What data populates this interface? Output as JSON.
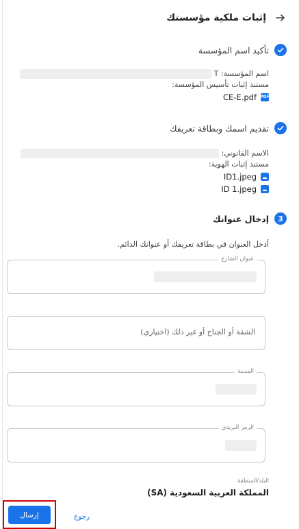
{
  "header": {
    "title": "إثبات ملكية مؤسستك",
    "back_icon": "arrow-right-icon"
  },
  "steps": [
    {
      "title": "تأكيد اسم المؤسسة",
      "status": "done",
      "lines": [
        {
          "label": "اسم المؤسسة: T"
        },
        {
          "label": "مستند إثبات تأسيس المؤسسة:"
        }
      ],
      "files": [
        {
          "name": "CE-E.pdf",
          "icon": "pdf-file-icon"
        }
      ]
    },
    {
      "title": "تقديم اسمك وبطاقة تعريفك",
      "status": "done",
      "lines": [
        {
          "label": "الاسم القانوني:"
        },
        {
          "label": "مستند إثبات الهوية:"
        }
      ],
      "files": [
        {
          "name": "ID1.jpeg",
          "icon": "image-file-icon"
        },
        {
          "name": "ID 1.jpeg",
          "icon": "image-file-icon"
        }
      ]
    },
    {
      "number": "3",
      "title": "إدخال عنوانك",
      "status": "current"
    }
  ],
  "address": {
    "instruction": "أدخل العنوان في بطاقة تعريفك أو عنوانك الدائم.",
    "street_label": "عنوان الشارع",
    "apt_placeholder": "الشقة أو الجناح أو غير ذلك (اختياري)",
    "city_label": "المدينة",
    "postal_label": "الرمز البريدي",
    "country_label": "البلد/المنطقة",
    "country_value": "المملكة العربية السعودية (SA)"
  },
  "actions": {
    "submit_label": "إرسال",
    "back_label": "رجوع"
  },
  "colors": {
    "accent": "#1a73e8",
    "highlight": "#d00000"
  }
}
